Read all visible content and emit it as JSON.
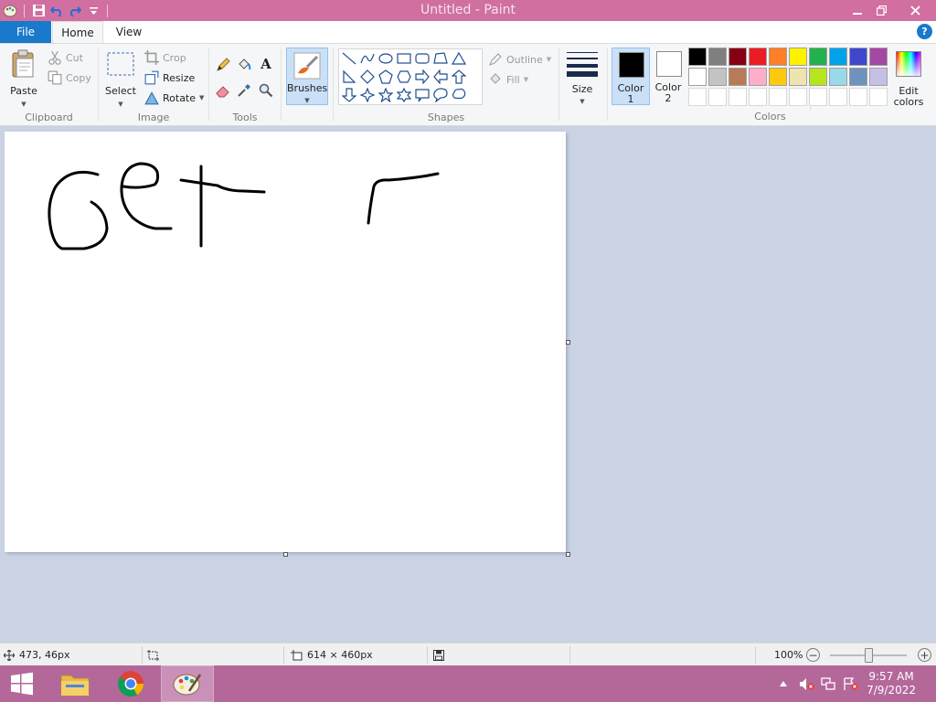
{
  "window": {
    "title": "Untitled - Paint"
  },
  "tabs": {
    "file": "File",
    "home": "Home",
    "view": "View",
    "help": "?"
  },
  "clipboard": {
    "paste": "Paste",
    "cut": "Cut",
    "copy": "Copy",
    "label": "Clipboard"
  },
  "image": {
    "select": "Select",
    "crop": "Crop",
    "resize": "Resize",
    "rotate": "Rotate",
    "label": "Image"
  },
  "tools": {
    "label": "Tools",
    "text_glyph": "A"
  },
  "brushes": {
    "label": "Brushes"
  },
  "shapes": {
    "outline": "Outline",
    "fill": "Fill",
    "label": "Shapes"
  },
  "size": {
    "label": "Size"
  },
  "colors": {
    "color1_label": "Color",
    "color1_num": "1",
    "color2_label": "Color",
    "color2_num": "2",
    "edit_label1": "Edit",
    "edit_label2": "colors",
    "label": "Colors",
    "color1": "#000000",
    "color2": "#ffffff",
    "row1": [
      "#000000",
      "#7f7f7f",
      "#880015",
      "#ed1c24",
      "#ff7f27",
      "#fff200",
      "#22b14c",
      "#00a2e8",
      "#3f48cc",
      "#a349a4"
    ],
    "row2": [
      "#ffffff",
      "#c3c3c3",
      "#b97a57",
      "#ffaec9",
      "#ffc90e",
      "#efe4b0",
      "#b5e61d",
      "#99d9ea",
      "#7092be",
      "#c8bfe7"
    ]
  },
  "status": {
    "cursor": "473, 46px",
    "canvas_size": "614 × 460px",
    "zoom": "100%",
    "zoom_out": "−",
    "zoom_in": "+"
  },
  "taskbar": {
    "time": "9:57 AM",
    "date": "7/9/2022"
  }
}
